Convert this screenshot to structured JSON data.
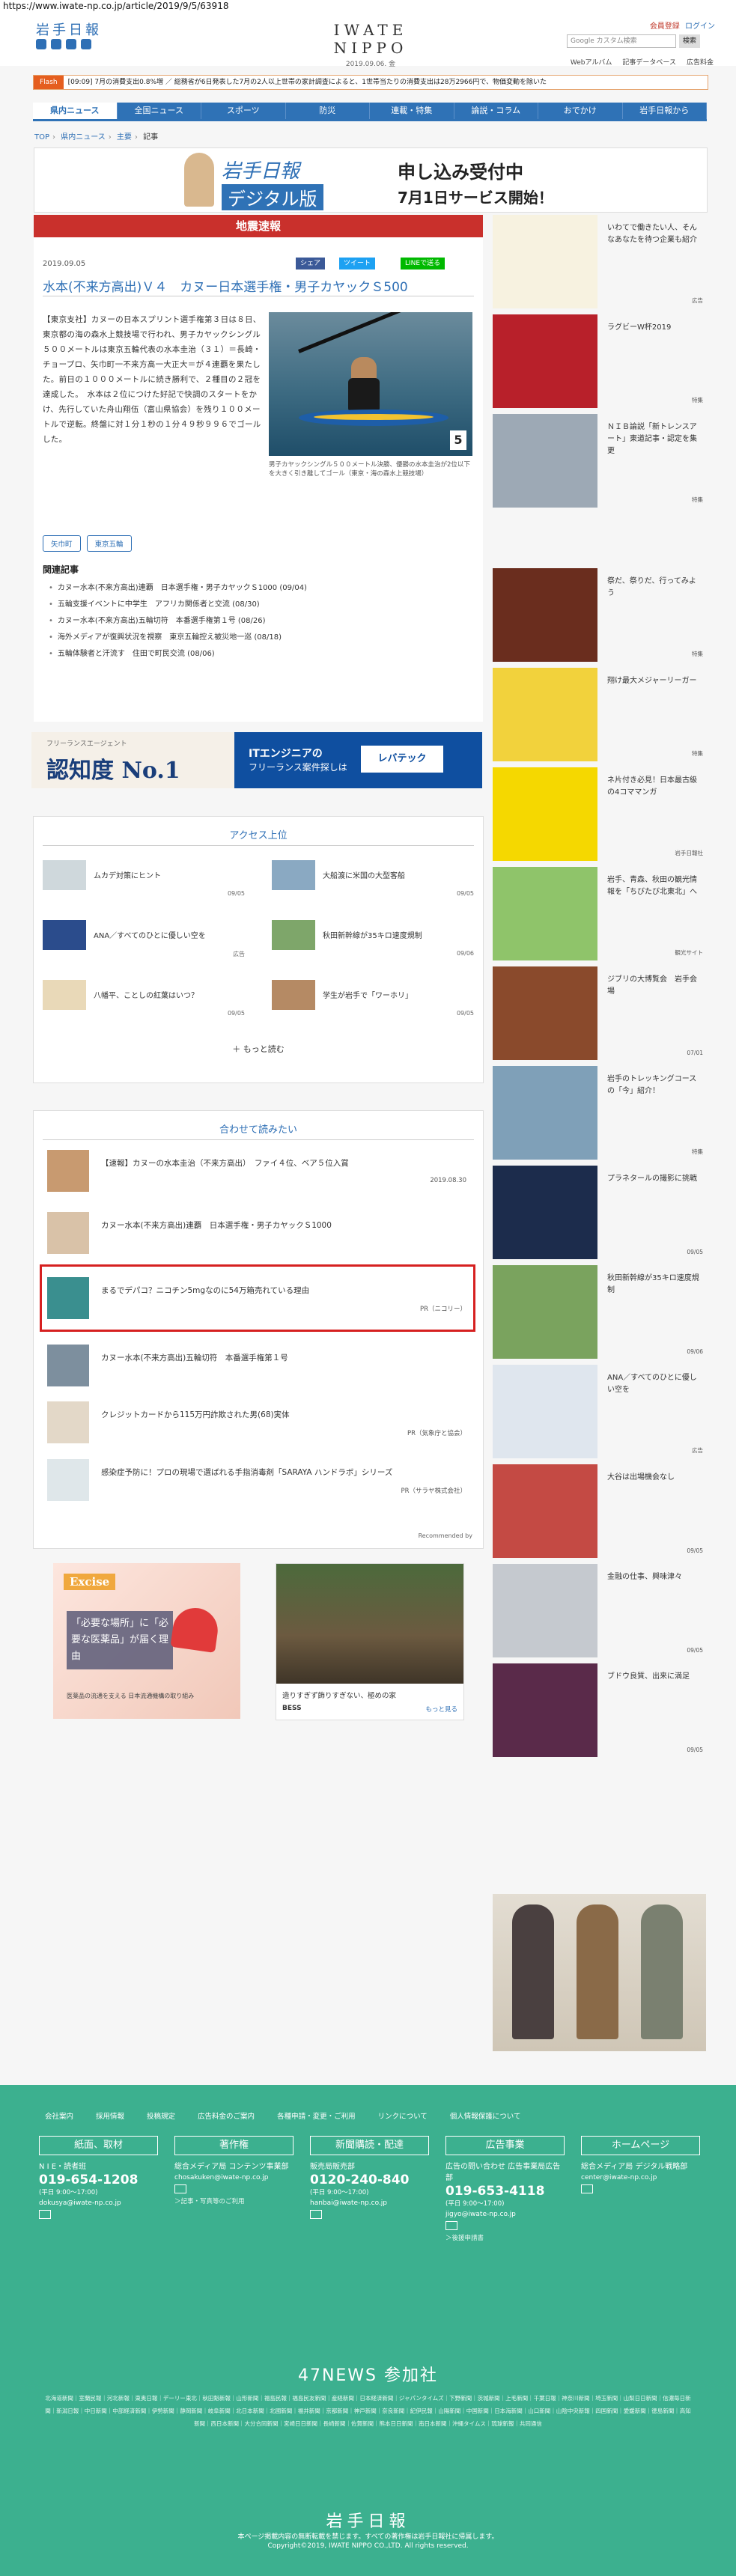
{
  "url": "https://www.iwate-np.co.jp/article/2019/9/5/63918",
  "header": {
    "logo": "岩手日報",
    "center_title": "IWATE NIPPO",
    "date": "2019.09.06. 金",
    "member": "会員登録",
    "login": "ログイン",
    "search_placeholder": "Google カスタム検索",
    "search_button": "検索",
    "menu": [
      "Webアルバム",
      "記事データベース",
      "広告料金"
    ]
  },
  "flash": {
    "tag": "Flash",
    "text": "[09:09] 7月の消費支出0.8%増 ／ 総務省が6日発表した7月の2人以上世帯の家計調査によると、1世帯当たりの消費支出は28万2966円で、物価変動を除いた"
  },
  "nav": [
    "県内ニュース",
    "全国ニュース",
    "スポーツ",
    "防災",
    "連載・特集",
    "論説・コラム",
    "おでかけ",
    "岩手日報から"
  ],
  "breadcrumb": [
    "TOP",
    "県内ニュース",
    "主要",
    "記事"
  ],
  "banner": {
    "t1": "岩手日報",
    "t2": "申し込み受付中",
    "s1": "デジタル版",
    "s2": "7月1日サービス開始！"
  },
  "article": {
    "quake": "地震速報",
    "date": "2019.09.05",
    "share": [
      "シェア",
      "ツイート",
      "LINEで送る"
    ],
    "title": "水本(不来方高出)Ｖ４　カヌー日本選手権・男子カヤックＳ500",
    "body": "【東京支社】カヌーの日本スプリント選手権第３日は８日、東京都の海の森水上競技場で行われ、男子カヤックシングル５００メートルは東京五輪代表の水本圭治（３１）＝長崎・チョープロ、矢巾町一不来方高一大正大＝が４連覇を果たした。前日の１０００メートルに続き勝利で、２種目の２冠を達成した。　水本は２位につけた好記で快調のスタートをかけ、先行していた舟山翔伍（富山県協会）を残り１００メートルで逆転。終盤に対１分１秒の１分４９秒９９６でゴールした。",
    "caption": "男子カヤックシングル５００メートル決勝、優勝の水本圭治が2位以下を大きく引き離してゴール（東京・海の森水上競技場）",
    "bib": "5",
    "tags": [
      "矢巾町",
      "東京五輪"
    ],
    "related_heading": "関連記事",
    "related": [
      "カヌー水本(不来方高出)連覇　日本選手権・男子カヤックＳ1000 (09/04)",
      "五輪支援イベントに中学生　アフリカ関係者と交流 (08/30)",
      "カヌー水本(不来方高出)五輪切符　本番選手権第１号 (08/26)",
      "海外メディアが復興状況を視察　東京五輪控え被災地一巡 (08/18)",
      "五輪体験者と汗流す　住田で町民交流 (08/06)"
    ]
  },
  "ad_freelance": {
    "a": "フリーランスエージェント",
    "b": "認知度 No.1",
    "c": "ITエンジニアの",
    "c2": "フリーランス案件探しは",
    "d": "レバテック"
  },
  "access": {
    "heading": "アクセス上位",
    "items": [
      {
        "text": "ムカデ対策にヒント",
        "date": "09/05"
      },
      {
        "text": "大船渡に米国の大型客船",
        "date": "09/05"
      },
      {
        "text": "ANA／すべてのひとに優しい空を",
        "date": "広告"
      },
      {
        "text": "秋田新幹線が35キロ速度規制",
        "date": "09/06"
      },
      {
        "text": "八幡平、ことしの紅葉はいつ？",
        "date": "09/05"
      },
      {
        "text": "学生が岩手で「ワーホリ」",
        "date": "09/05"
      }
    ],
    "more": "＋ もっと読む"
  },
  "recommend": {
    "heading": "合わせて読みたい",
    "items": [
      {
        "text": "【速報】カヌーの水本圭治（不来方高出）　ファイ４位、ベア５位入賞",
        "meta": "2019.08.30"
      },
      {
        "text": "カヌー水本(不来方高出)連覇　日本選手権・男子カヤックＳ1000",
        "meta": ""
      },
      {
        "text": "まるでデパコ？ニコチン5mgなのに54万箱売れている理由",
        "meta": "PR（ニコリー）"
      },
      {
        "text": "カヌー水本(不来方高出)五輪切符　本番選手権第１号",
        "meta": ""
      },
      {
        "text": "クレジットカードから115万円詐欺された男(68)実体",
        "meta": "PR（気象庁と協会）"
      },
      {
        "text": "感染症予防に！プロの現場で選ばれる手指消毒剤「SARAYA ハンドラボ」シリーズ",
        "meta": "PR（サラヤ株式会社）"
      }
    ],
    "foot": "Recommended by"
  },
  "ad_excise": {
    "logo": "Excise",
    "txt": "「必要な場所」に「必要な医薬品」が届く理由",
    "small": "医薬品の流通を支える 日本流通機構の取り組み"
  },
  "ad_house": {
    "t": "造りすぎず飾りすぎない、極めの家",
    "b": "BESS",
    "r": "もっと見る"
  },
  "sidebar": [
    {
      "text": "いわてで働きたい人、そんなあなたを待つ企業も紹介",
      "src": "広告"
    },
    {
      "text": "ラグビーW杯2019",
      "src": "特集"
    },
    {
      "text": "ＮＩＢ論説「新トレンスアート」東道記事・認定を集更",
      "src": "特集"
    },
    {
      "text": "祭だ、祭りだ、行ってみよう",
      "src": "特集"
    },
    {
      "text": "翔け最大メジャーリーガー",
      "src": "特集"
    },
    {
      "text": "ネ片付き必見！日本最古級の4コママンガ",
      "src": "岩手日報社"
    },
    {
      "text": "岩手、青森、秋田の観光情報を「ちびたび北東北」へ",
      "src": "観光サイト"
    },
    {
      "text": "ジブリの大博覧会　岩手会場",
      "src": "07/01"
    },
    {
      "text": "岩手のトレッキングコースの「今」紹介！",
      "src": "特集"
    },
    {
      "text": "プラネタールの撮影に挑戦",
      "src": "09/05"
    },
    {
      "text": "秋田新幹線が35キロ速度規制",
      "src": "09/06"
    },
    {
      "text": "ANA／すべてのひとに優しい空を",
      "src": "広告"
    },
    {
      "text": "大谷は出場機会なし",
      "src": "09/05"
    },
    {
      "text": "金融の仕事、興味津々",
      "src": "09/05"
    },
    {
      "text": "ブドウ良質、出来に満足",
      "src": "09/05"
    }
  ],
  "footer": {
    "links": [
      "会社案内",
      "採用情報",
      "投稿規定",
      "広告料金のご案内",
      "各種申請・変更・ご利用",
      "リンクについて",
      "個人情報保護について"
    ],
    "cols": [
      {
        "h": "紙面、取材",
        "l1": "N I E・読者班",
        "tel": "019-654-1208",
        "hrs": "(平日 9:00～17:00)",
        "mail": "dokusya@iwate-np.co.jp",
        "link": ""
      },
      {
        "h": "著作権",
        "l1": "総合メディア局 コンテンツ事業部",
        "tel": "",
        "hrs": "",
        "mail": "chosakuken@iwate-np.co.jp",
        "link": "＞記事・写真等のご利用"
      },
      {
        "h": "新聞購読・配達",
        "l1": "販売局販売部",
        "tel": "0120-240-840",
        "hrs": "(平日 9:00～17:00)",
        "mail": "hanbai@iwate-np.co.jp",
        "link": ""
      },
      {
        "h": "広告事業",
        "l1": "広告の問い合わせ 広告事業局広告部",
        "tel": "019-653-4118",
        "hrs": "(平日 9:00～17:00)",
        "mail": "jigyo@iwate-np.co.jp",
        "link": "＞後援申請書"
      },
      {
        "h": "ホームページ",
        "l1": "総合メディア局 デジタル戦略部",
        "tel": "",
        "hrs": "",
        "mail": "center@iwate-np.co.jp",
        "link": ""
      }
    ],
    "news47": "47NEWS 参加社",
    "news_list": "北海道新聞｜室蘭民報｜河北新報｜東奥日報｜デーリー東北｜秋田魁新報｜山形新聞｜福島民報｜福島民友新聞｜産経新聞｜日本経済新聞｜ジャパンタイムズ｜下野新聞｜茨城新聞｜上毛新聞｜千葉日報｜神奈川新聞｜埼玉新聞｜山梨日日新聞｜信濃毎日新聞｜新潟日報｜中日新聞｜中部経済新聞｜伊勢新聞｜静岡新聞｜岐阜新聞｜北日本新聞｜北國新聞｜福井新聞｜京都新聞｜神戸新聞｜奈良新聞｜紀伊民報｜山陽新聞｜中国新聞｜日本海新聞｜山口新聞｜山陰中央新報｜四国新聞｜愛媛新聞｜徳島新聞｜高知新聞｜西日本新聞｜大分合同新聞｜宮崎日日新聞｜長崎新聞｜佐賀新聞｜熊本日日新聞｜南日本新聞｜沖縄タイムス｜琉球新報｜共同通信",
    "logo": "岩手日報",
    "copy1": "本ページ掲載内容の無断転載を禁じます。すべての著作権は岩手日報社に帰属します。",
    "copy2": "Copyright©2019, IWATE NIPPO CO.,LTD. All rights reserved."
  },
  "colors": {
    "primary": "#2f72b6",
    "quake": "#c9302c",
    "footer": "#3cb08f",
    "highlight": "#d62020"
  }
}
